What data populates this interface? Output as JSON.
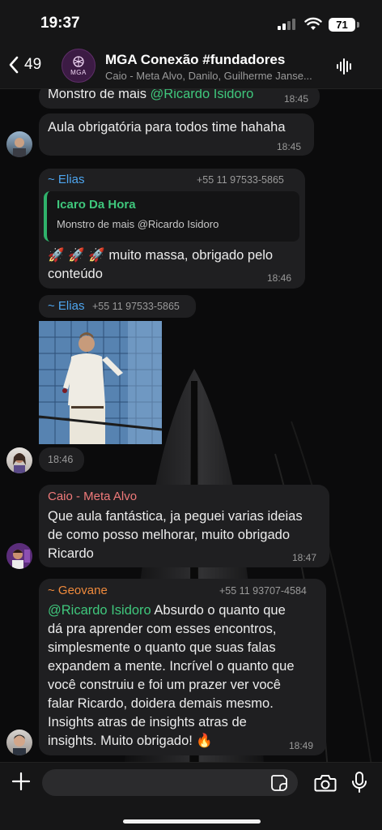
{
  "status": {
    "time": "19:37",
    "battery": "71"
  },
  "header": {
    "back_count": "49",
    "title": "MGA Conexão #fundadores",
    "subtitle": "Caio - Meta Alvo, Danilo, Guilherme Janse...",
    "avatar_text": "MGA"
  },
  "messages": [
    {
      "text_before": "Monstro de mais ",
      "mention": "@Ricardo Isidoro",
      "time": "18:45"
    },
    {
      "text": "Aula obrigatória para todos time hahaha",
      "time": "18:45"
    },
    {
      "sender": "~ Elias",
      "phone": "+55 11 97533-5865",
      "quote": {
        "name": "Icaro Da Hora",
        "text": "Monstro de mais @Ricardo Isidoro"
      },
      "emoji": "🚀 🚀 🚀",
      "line1": " muito massa,  obrigado pelo",
      "line2": "conteúdo",
      "time": "18:46"
    },
    {
      "sender": "~ Elias",
      "phone": "+55 11 97533-5865",
      "time": "18:46"
    },
    {
      "sender": "Caio - Meta Alvo",
      "lines": [
        "Que aula fantástica, ja peguei varias ideias",
        "de como posso melhorar, muito obrigado",
        "Ricardo"
      ],
      "time": "18:47"
    },
    {
      "sender": "~ Geovane",
      "phone": "+55 11 93707-4584",
      "mention": "@Ricardo Isidoro",
      "first_line_rest": " Absurdo o quanto que",
      "lines": [
        "dá pra aprender com esses encontros,",
        "simplesmente o quanto que suas falas",
        "expandem a mente. Incrível o quanto que",
        "você construiu e foi um prazer ver você",
        "falar Ricardo, doidera demais mesmo.",
        "Insights atras de insights atras de"
      ],
      "last_line": "insights. Muito obrigado! 🔥",
      "time": "18:49"
    }
  ],
  "colors": {
    "mention": "#3fc77c",
    "elias": "#4ea6f0",
    "caio": "#f07a7a",
    "geovane": "#f08a3c",
    "bubble": "#1f1f21"
  },
  "icons": [
    "chevron-left-icon",
    "waveform-icon",
    "plus-icon",
    "sticker-icon",
    "camera-icon",
    "mic-icon"
  ]
}
